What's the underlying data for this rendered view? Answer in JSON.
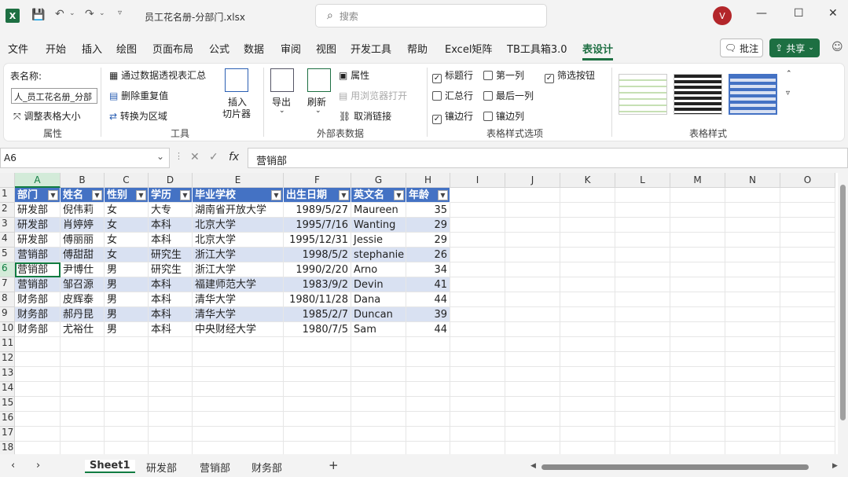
{
  "titlebar": {
    "app_icon": "X",
    "title": "员工花名册-分部门.xlsx",
    "search_placeholder": "搜索",
    "avatar": "V"
  },
  "menu": [
    "文件",
    "开始",
    "插入",
    "绘图",
    "页面布局",
    "公式",
    "数据",
    "审阅",
    "视图",
    "开发工具",
    "帮助",
    "Excel矩阵",
    "TB工具箱3.0",
    "表设计"
  ],
  "menu_active_index": 13,
  "buttons": {
    "comment": "批注",
    "share": "共享"
  },
  "ribbon": {
    "props_group": {
      "label": "属性",
      "table_name_label": "表名称:",
      "table_name": "人_员工花名册_分部",
      "resize": "调整表格大小"
    },
    "tools_group": {
      "label": "工具",
      "pivot": "通过数据透视表汇总",
      "dedupe": "删除重复值",
      "convert": "转换为区域",
      "slicer1": "插入",
      "slicer2": "切片器"
    },
    "ext_group": {
      "label": "外部表数据",
      "export": "导出",
      "refresh": "刷新",
      "properties": "属性",
      "open_browser": "用浏览器打开",
      "unlink": "取消链接"
    },
    "style_opts": {
      "label": "表格样式选项",
      "header_row": "标题行",
      "total_row": "汇总行",
      "banded_rows": "镶边行",
      "first_col": "第一列",
      "last_col": "最后一列",
      "banded_cols": "镶边列",
      "filter_btn": "筛选按钮"
    },
    "styles_group": {
      "label": "表格样式"
    }
  },
  "formula": {
    "namebox": "A6",
    "fx": "fx",
    "value": "营销部"
  },
  "columns": [
    "A",
    "B",
    "C",
    "D",
    "E",
    "F",
    "G",
    "H",
    "I",
    "J",
    "K",
    "L",
    "M",
    "N",
    "O"
  ],
  "rows": [
    "1",
    "2",
    "3",
    "4",
    "5",
    "6",
    "7",
    "8",
    "9",
    "10",
    "11",
    "12",
    "13",
    "14",
    "15",
    "16",
    "17",
    "18"
  ],
  "table": {
    "headers": [
      "部门",
      "姓名",
      "性别",
      "学历",
      "毕业学校",
      "出生日期",
      "英文名",
      "年龄"
    ],
    "data": [
      [
        "研发部",
        "倪伟莉",
        "女",
        "大专",
        "湖南省开放大学",
        "1989/5/27",
        "Maureen",
        "35"
      ],
      [
        "研发部",
        "肖婷婷",
        "女",
        "本科",
        "北京大学",
        "1995/7/16",
        "Wanting",
        "29"
      ],
      [
        "研发部",
        "傅丽丽",
        "女",
        "本科",
        "北京大学",
        "1995/12/31",
        "Jessie",
        "29"
      ],
      [
        "营销部",
        "傅甜甜",
        "女",
        "研究生",
        "浙江大学",
        "1998/5/2",
        "stephanie",
        "26"
      ],
      [
        "营销部",
        "尹博仕",
        "男",
        "研究生",
        "浙江大学",
        "1990/2/20",
        "Arno",
        "34"
      ],
      [
        "营销部",
        "邹召源",
        "男",
        "本科",
        "福建师范大学",
        "1983/9/2",
        "Devin",
        "41"
      ],
      [
        "财务部",
        "皮辉泰",
        "男",
        "本科",
        "清华大学",
        "1980/11/28",
        "Dana",
        "44"
      ],
      [
        "财务部",
        "郝丹昆",
        "男",
        "本科",
        "清华大学",
        "1985/2/7",
        "Duncan",
        "39"
      ],
      [
        "财务部",
        "尤裕仕",
        "男",
        "本科",
        "中央财经大学",
        "1980/7/5",
        "Sam",
        "44"
      ]
    ]
  },
  "sheets": [
    "Sheet1",
    "研发部",
    "营销部",
    "财务部"
  ],
  "sheet_active_index": 0,
  "colors": {
    "accent": "#1d6f42",
    "table_header": "#4472c4",
    "band": "#d9e1f2"
  }
}
